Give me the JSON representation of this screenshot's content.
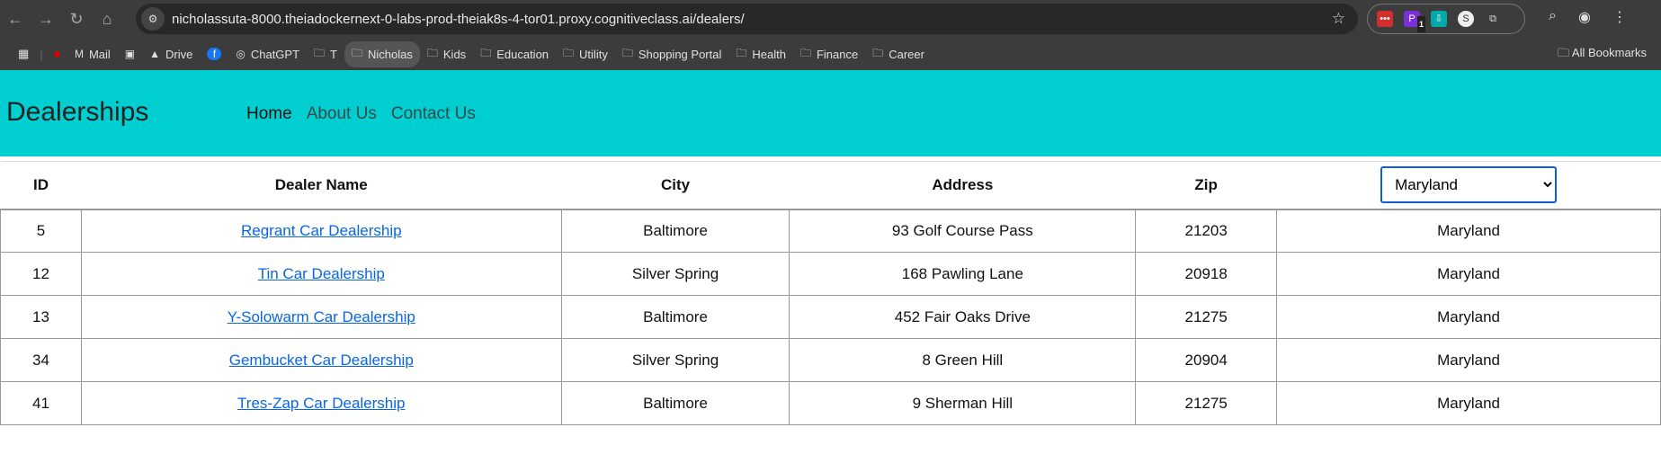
{
  "browser": {
    "url": "nicholassuta-8000.theiadockernext-0-labs-prod-theiak8s-4-tor01.proxy.cognitiveclass.ai/dealers/",
    "bookmarks": [
      {
        "label": "",
        "icon": "cnn-icon"
      },
      {
        "label": "Mail",
        "icon": "gmail-icon"
      },
      {
        "label": "",
        "icon": "calendar-icon"
      },
      {
        "label": "Drive",
        "icon": "drive-icon"
      },
      {
        "label": "",
        "icon": "facebook-icon"
      },
      {
        "label": "ChatGPT",
        "icon": "chatgpt-icon"
      },
      {
        "label": "T",
        "icon": "folder-icon"
      },
      {
        "label": "Nicholas",
        "icon": "folder-icon"
      },
      {
        "label": "Kids",
        "icon": "folder-icon"
      },
      {
        "label": "Education",
        "icon": "folder-icon"
      },
      {
        "label": "Utility",
        "icon": "folder-icon"
      },
      {
        "label": "Shopping Portal",
        "icon": "folder-icon"
      },
      {
        "label": "Health",
        "icon": "folder-icon"
      },
      {
        "label": "Finance",
        "icon": "folder-icon"
      },
      {
        "label": "Career",
        "icon": "folder-icon"
      }
    ],
    "all_bookmarks": "All Bookmarks",
    "ext_badge": "1"
  },
  "header": {
    "title": "Dealerships",
    "nav": [
      "Home",
      "About Us",
      "Contact Us"
    ],
    "bg": "#00ced1"
  },
  "table": {
    "columns": [
      "ID",
      "Dealer Name",
      "City",
      "Address",
      "Zip"
    ],
    "state_filter": "Maryland",
    "rows": [
      {
        "id": "5",
        "name": "Regrant Car Dealership",
        "city": "Baltimore",
        "address": "93 Golf Course Pass",
        "zip": "21203",
        "state": "Maryland"
      },
      {
        "id": "12",
        "name": "Tin Car Dealership",
        "city": "Silver Spring",
        "address": "168 Pawling Lane",
        "zip": "20918",
        "state": "Maryland"
      },
      {
        "id": "13",
        "name": "Y-Solowarm Car Dealership",
        "city": "Baltimore",
        "address": "452 Fair Oaks Drive",
        "zip": "21275",
        "state": "Maryland"
      },
      {
        "id": "34",
        "name": "Gembucket Car Dealership",
        "city": "Silver Spring",
        "address": "8 Green Hill",
        "zip": "20904",
        "state": "Maryland"
      },
      {
        "id": "41",
        "name": "Tres-Zap Car Dealership",
        "city": "Baltimore",
        "address": "9 Sherman Hill",
        "zip": "21275",
        "state": "Maryland"
      }
    ]
  }
}
